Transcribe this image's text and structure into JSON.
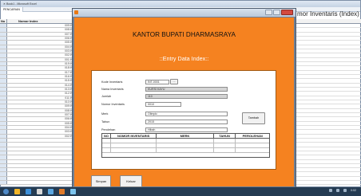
{
  "bg_window": {
    "title": "✕ Book1 - Microsoft Excel",
    "tab": "PENCARIAN",
    "sheet_heading": "mor Inventaris (Index)",
    "left_grid": {
      "col_no": "No",
      "col_name": "Nomor Index",
      "rows": [
        "009 INT",
        "008 INT",
        "007 INT",
        "006 INT",
        "005 INT",
        "004 INT",
        "003 INT",
        "002 INT",
        "001 INT",
        "019 INT",
        "018 INT",
        "017 INT",
        "016 INT",
        "015 INT",
        "014 INT",
        "013 INT",
        "012 INT",
        "011 INT",
        "010 INT",
        "009 INT",
        "008 INT",
        "007 INT",
        "006 INT",
        "005 INT",
        "004 INT",
        "003 INT",
        "002 INT",
        "",
        "",
        "",
        "",
        "",
        "",
        "",
        "",
        "",
        "",
        ""
      ]
    },
    "right_grid": {
      "col_name": "nm"
    }
  },
  "form": {
    "org_title": "KANTOR BUPATI DHARMASRAYA",
    "heading": "::Entry Data Index::",
    "fields": {
      "kode_label": "Kode Inventaris",
      "kode_value": "INT-0001",
      "nama_label": "Nama Inventaris",
      "nama_value": "KURSI KAYU",
      "jumlah_label": "Jumlah",
      "jumlah_value": "110",
      "nomor_label": "Nomor Inventaris",
      "nomor_value": "0010",
      "merk_label": "Merk",
      "merk_value": "Olimpic",
      "tahun_label": "Tahun",
      "tahun_value": "2015",
      "perolehan_label": "Perolehan",
      "perolehan_value": "Hibah"
    },
    "browse_button": "...",
    "tambah_button": "Tambah",
    "table": {
      "headers": [
        "NO",
        "NOMOR INVENTARIS",
        "MERK",
        "TAHUN",
        "PEROLEHAN"
      ],
      "rows": [
        [
          "",
          "",
          "",
          "",
          ""
        ],
        [
          "",
          "",
          "",
          "",
          ""
        ],
        [
          "",
          "",
          "",
          "",
          ""
        ]
      ]
    },
    "simpan_button": "Simpan",
    "keluar_button": "Keluar"
  },
  "taskbar": {
    "clock": "0:02",
    "icon_colors": [
      "#f0b428",
      "#3c8fd9",
      "#d8d8d8",
      "#5aa6e0",
      "#e07a2a",
      "#7cc4ee"
    ]
  }
}
